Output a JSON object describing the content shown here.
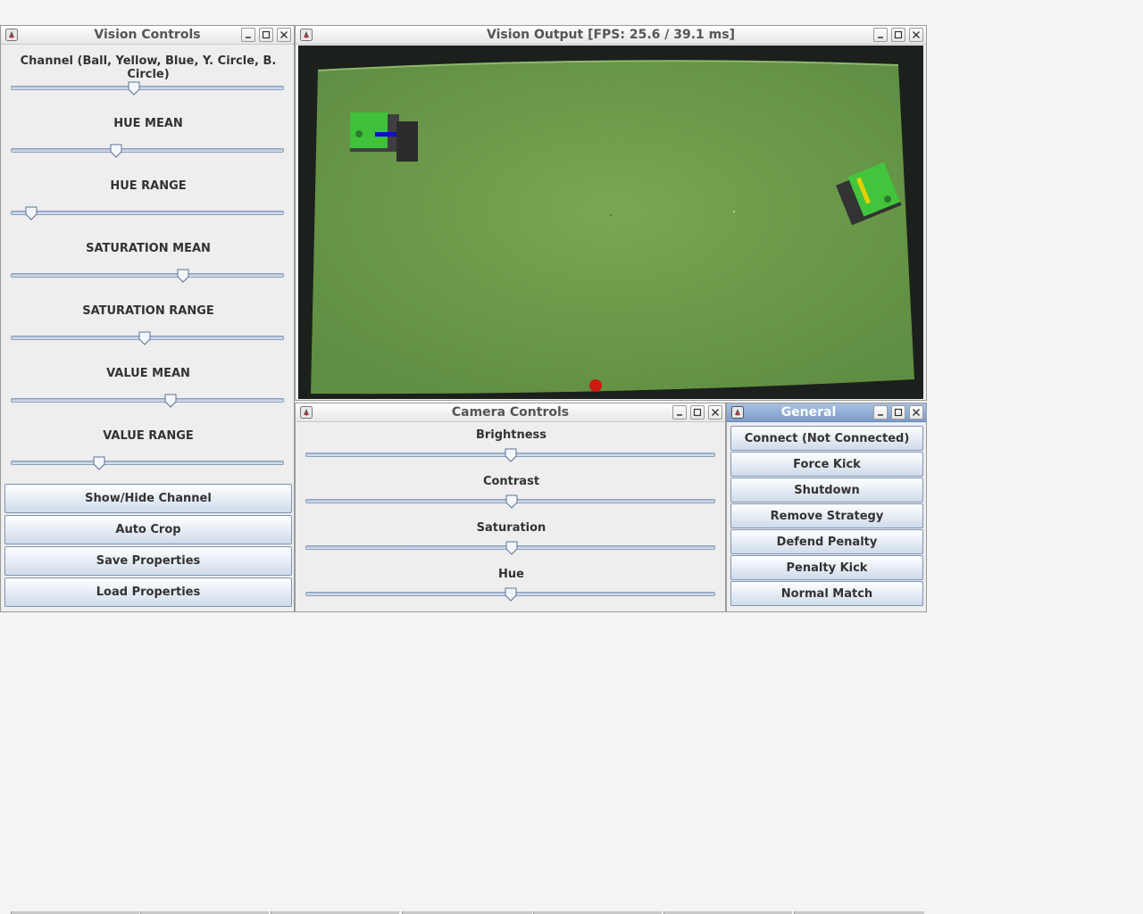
{
  "vision_controls": {
    "title": "Vision Controls",
    "sliders": [
      {
        "label": "Channel (Ball, Yellow, Blue, Y. Circle, B. Circle)",
        "value": 0.45
      },
      {
        "label": "HUE MEAN",
        "value": 0.385
      },
      {
        "label": "HUE RANGE",
        "value": 0.075
      },
      {
        "label": "SATURATION MEAN",
        "value": 0.63
      },
      {
        "label": "SATURATION RANGE",
        "value": 0.49
      },
      {
        "label": "VALUE MEAN",
        "value": 0.585
      },
      {
        "label": "VALUE RANGE",
        "value": 0.325
      }
    ],
    "buttons": [
      "Show/Hide Channel",
      "Auto Crop",
      "Save Properties",
      "Load Properties"
    ]
  },
  "vision_output": {
    "title": "Vision Output [FPS: 25.6 / 39.1 ms]",
    "field_color": "#6f9c4d",
    "yellow_marker_color": "#e6d200",
    "blue_marker_color": "#1010c0",
    "ball_color": "#cc1a0f"
  },
  "camera_controls": {
    "title": "Camera Controls",
    "sliders": [
      {
        "label": "Brightness",
        "value": 0.502
      },
      {
        "label": "Contrast",
        "value": 0.503
      },
      {
        "label": "Saturation",
        "value": 0.503
      },
      {
        "label": "Hue",
        "value": 0.502
      }
    ]
  },
  "general": {
    "title": "General",
    "buttons": [
      "Connect (Not Connected)",
      "Force Kick",
      "Shutdown",
      "Remove Strategy",
      "Defend Penalty",
      "Penalty Kick",
      "Normal Match"
    ]
  },
  "colors": {
    "active_title": "#7c9cc8",
    "button_border": "#7d94b4",
    "slider_track": "#a9bbd4"
  }
}
